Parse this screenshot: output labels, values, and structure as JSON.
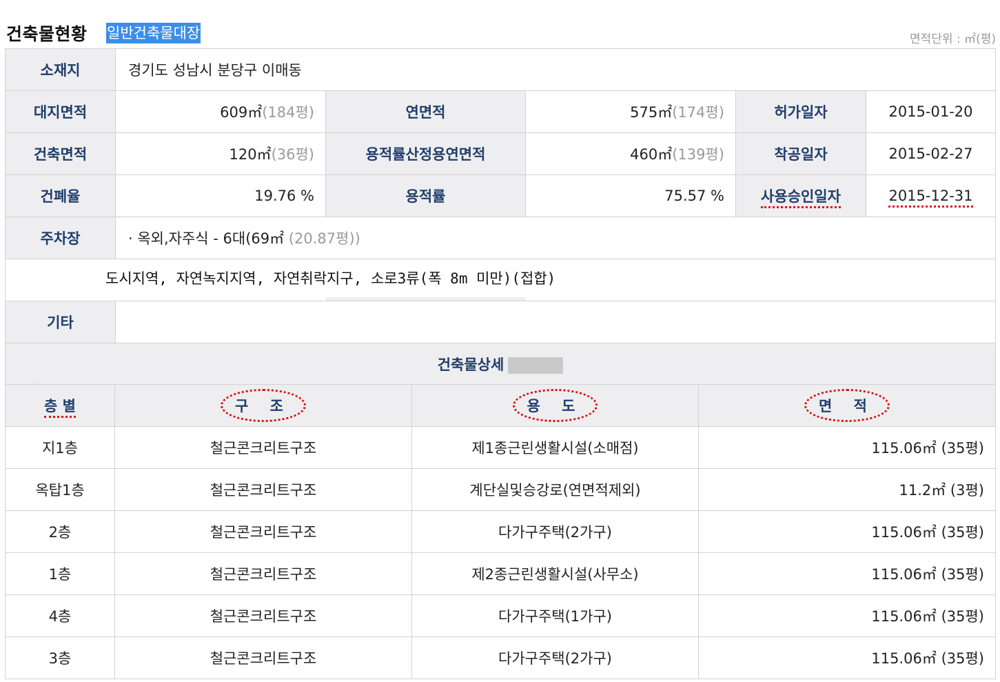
{
  "header": {
    "title": "건축물현황",
    "subtitle": "일반건축물대장",
    "unit": "면적단위 : ㎡(평)"
  },
  "info": {
    "location_label": "소재지",
    "location": "경기도 성남시 분당구 이매동",
    "site_area_label": "대지면적",
    "site_area": "609㎡",
    "site_area_py": "(184평)",
    "floor_area_label": "연면적",
    "floor_area": "575㎡",
    "floor_area_py": "(174평)",
    "permit_date_label": "허가일자",
    "permit_date": "2015-01-20",
    "building_area_label": "건축면적",
    "building_area": "120㎡",
    "building_area_py": "(36평)",
    "far_area_label": "용적률산정용연면적",
    "far_area": "460㎡",
    "far_area_py": "(139평)",
    "start_date_label": "착공일자",
    "start_date": "2015-02-27",
    "bcr_label": "건폐율",
    "bcr": "19.76 %",
    "far_label": "용적률",
    "far": "75.57 %",
    "approval_date_label": "사용승인일자",
    "approval_date": "2015-12-31",
    "parking_label": "주차장",
    "parking": "· 옥외,자주식 - 6대(69㎡",
    "parking_py": "(20.87평))",
    "zoning": "도시지역, 자연녹지지역, 자연취락지구, 소로3류(폭 8m 미만)(접합)",
    "etc_label": "기타",
    "etc": ""
  },
  "detail": {
    "title": "건축물상세",
    "headers": [
      "층 별",
      "구 조",
      "용 도",
      "면 적"
    ],
    "rows": [
      {
        "floor": "지1층",
        "structure": "철근콘크리트구조",
        "use": "제1종근린생활시설(소매점)",
        "area": "115.06㎡",
        "area_py": "(35평)"
      },
      {
        "floor": "옥탑1층",
        "structure": "철근콘크리트구조",
        "use": "계단실및승강로(연면적제외)",
        "area": "11.2㎡",
        "area_py": "(3평)"
      },
      {
        "floor": "2층",
        "structure": "철근콘크리트구조",
        "use": "다가구주택(2가구)",
        "area": "115.06㎡",
        "area_py": "(35평)"
      },
      {
        "floor": "1층",
        "structure": "철근콘크리트구조",
        "use": "제2종근린생활시설(사무소)",
        "area": "115.06㎡",
        "area_py": "(35평)"
      },
      {
        "floor": "4층",
        "structure": "철근콘크리트구조",
        "use": "다가구주택(1가구)",
        "area": "115.06㎡",
        "area_py": "(35평)"
      },
      {
        "floor": "3층",
        "structure": "철근콘크리트구조",
        "use": "다가구주택(2가구)",
        "area": "115.06㎡",
        "area_py": "(35평)"
      }
    ]
  },
  "colors": {
    "label_text": "#1f3d6b",
    "label_bg": "#eeeef0",
    "annotation": "#e01010",
    "highlight": "#3b8eea"
  }
}
